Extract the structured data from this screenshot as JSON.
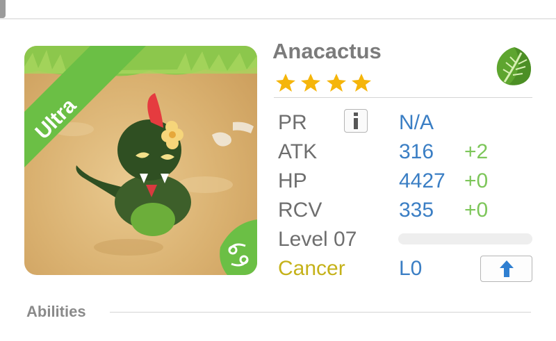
{
  "monster": {
    "name": "Anacactus",
    "rarity": "Ultra",
    "stars": 4,
    "attribute_icon": "leaf-icon",
    "sign_icon": "cancer-icon"
  },
  "stats": {
    "pr": {
      "label": "PR",
      "value": "N/A"
    },
    "atk": {
      "label": "ATK",
      "value": "316",
      "plus": "+2"
    },
    "hp": {
      "label": "HP",
      "value": "4427",
      "plus": "+0"
    },
    "rcv": {
      "label": "RCV",
      "value": "335",
      "plus": "+0"
    },
    "level_label": "Level 07",
    "level_progress": 0,
    "sign": "Cancer",
    "skill_level": "L0"
  },
  "sections": {
    "abilities": "Abilities"
  },
  "colors": {
    "value_blue": "#3a7ec4",
    "plus_green": "#7dc65a",
    "sign_gold": "#c5b21a",
    "rarity_green": "#6bbf45"
  }
}
